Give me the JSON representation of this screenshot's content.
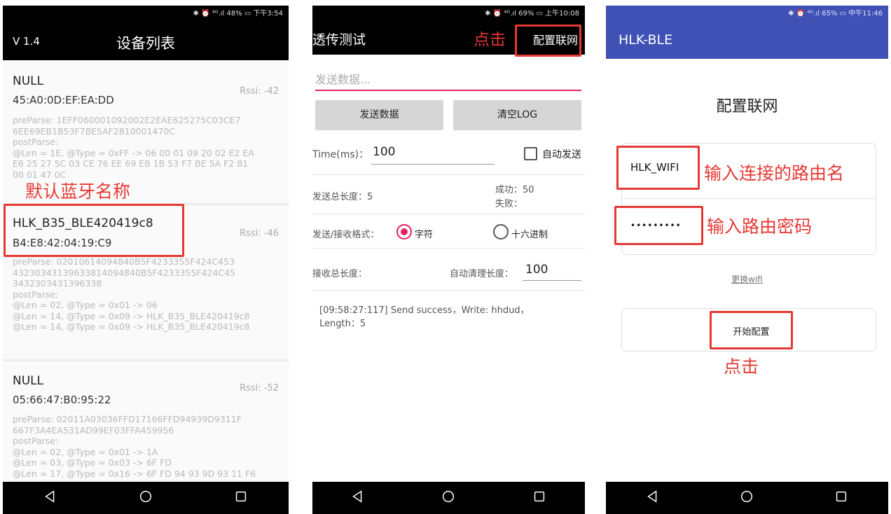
{
  "phone1": {
    "version": "V 1.4",
    "title": "设备列表",
    "devices": [
      {
        "name": "NULL",
        "mac": "45:A0:0D:EF:EA:DD",
        "rssi": "Rssi: -42",
        "raw": "preParse: 1EFF060001092002E2EAE625275C03CE7\n6EE69EB1B53F7BE5AF2810001470C\npostParse:\n@Len = 1E, @Type = 0xFF -> 06 00 01 09 20 02 E2 EA\nE6 25 27 5C 03 CE 76 EE 69 EB 1B 53 F7 BE 5A F2 81\n00 01 47 0C"
      },
      {
        "name": "HLK_B35_BLE420419c8",
        "mac": "B4:E8:42:04:19:C9",
        "rssi": "Rssi: -46",
        "raw": "preParse: 02010614094840B5F4233355F424C453\n43230343139633814094840B5F4233355F424C45\n3432303431396338\npostParse:\n@Len = 02, @Type = 0x01 -> 06\n@Len = 14, @Type = 0x09 -> HLK_B35_BLE420419c8\n@Len = 14, @Type = 0x09 -> HLK_B35_BLE420419c8"
      },
      {
        "name": "NULL",
        "mac": "05:66:47:B0:95:22",
        "rssi": "Rssi: -52",
        "raw": "preParse: 02011A03036FFD17166FFD94939D9311F\n667F3A4EA531AD99EF03FFA459956\npostParse:\n@Len = 02, @Type = 0x01 -> 1A\n@Len = 03, @Type = 0x03 -> 6F FD\n@Len = 17, @Type = 0x16 -> 6F FD 94 93 9D 93 11 F6"
      }
    ],
    "annotation": "默认蓝牙名称"
  },
  "phone2": {
    "title": "透传测试",
    "annotation_click": "点击",
    "menu_configure": "配置联网",
    "send_placeholder": "发送数据...",
    "btn_send": "发送数据",
    "btn_clear": "清空LOG",
    "time_label": "Time(ms)：",
    "time_value": "100",
    "auto_send": "自动发送",
    "total_sent_label": "发送总长度：5",
    "success_label": "成功：50",
    "fail_label": "失败：",
    "format_label": "发送/接收格式：",
    "format_char": "字符",
    "format_hex": "十六进制",
    "recv_total_label": "接收总长度：",
    "auto_clear_label": "自动清理长度：",
    "auto_clear_value": "100",
    "log_line1": "[09:58:27:117] Send success，Write: hhdud，",
    "log_line2": "Length：5"
  },
  "phone3": {
    "app_title": "HLK-BLE",
    "heading": "配置联网",
    "ssid_value": "HLK_WIFI",
    "password_value": "•••••••••",
    "annotation_ssid": "输入连接的路由名",
    "annotation_password": "输入路由密码",
    "change_wifi": "更换wifi",
    "start_button": "开始配置",
    "annotation_click": "点击"
  },
  "status": {
    "p1": "✱ ⏰ ⁴ᴳ.ıl 48% ▭ 下午3:54",
    "p2": "✱ ⏰ ⁴ᴳ.ıl 69% ▭ 上午10:08",
    "p3": "✱ ⏰ ⁴ᴳ.ıl 65% ▭ 中午11:46"
  },
  "colors": {
    "annotation_red": "#e53935",
    "accent_pink": "#e91e63",
    "app_bar_blue": "#3f51b5"
  },
  "icons": [
    "back-icon",
    "home-icon",
    "recents-icon",
    "checkbox-icon",
    "radio-icon"
  ]
}
